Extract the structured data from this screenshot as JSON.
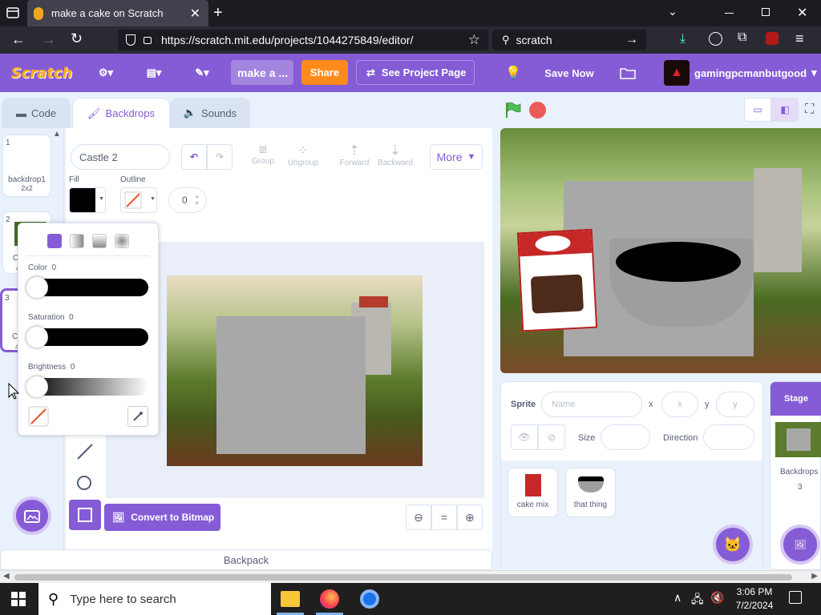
{
  "browser": {
    "tab_title": "make a cake on Scratch",
    "url": "https://scratch.mit.edu/projects/1044275849/editor/",
    "search_text": "scratch",
    "new_tab_glyph": "+"
  },
  "menubar": {
    "logo": "Scratch",
    "project_title": "make a ...",
    "share_label": "Share",
    "see_project_page": "See Project Page",
    "save_now": "Save Now",
    "username": "gamingpcmanbutgood"
  },
  "tabs": {
    "code": "Code",
    "backdrops": "Backdrops",
    "sounds": "Sounds"
  },
  "costume_list": [
    {
      "number": "1",
      "name": "backdrop1",
      "size": "2x2"
    },
    {
      "number": "2",
      "name": "C",
      "size": "4"
    },
    {
      "number": "3",
      "name": "C",
      "size": "4"
    }
  ],
  "paint_editor": {
    "costume_name": "Castle 2",
    "tools": {
      "group": "Group",
      "ungroup": "Ungroup",
      "forward": "Forward",
      "backward": "Backward",
      "more": "More"
    },
    "fill_label": "Fill",
    "outline_label": "Outline",
    "outline_width": "0",
    "convert_label": "Convert to Bitmap",
    "zoom_reset": "="
  },
  "color_popover": {
    "color_label": "Color",
    "color_value": "0",
    "saturation_label": "Saturation",
    "saturation_value": "0",
    "brightness_label": "Brightness",
    "brightness_value": "0"
  },
  "sprite_info": {
    "sprite_label": "Sprite",
    "name_placeholder": "Name",
    "x_label": "x",
    "x_placeholder": "x",
    "y_label": "y",
    "y_placeholder": "y",
    "size_label": "Size",
    "direction_label": "Direction"
  },
  "sprites": [
    {
      "name": "cake mix"
    },
    {
      "name": "that thing"
    }
  ],
  "stage_panel": {
    "title": "Stage",
    "backdrops_label": "Backdrops",
    "backdrops_count": "3"
  },
  "backpack": {
    "label": "Backpack"
  },
  "taskbar": {
    "search_placeholder": "Type here to search",
    "time": "3:06 PM",
    "date": "7/2/2024"
  },
  "colors": {
    "scratch_purple": "#855cd6",
    "share_orange": "#ff8c1a",
    "accent_blue": "#4c97ff"
  }
}
